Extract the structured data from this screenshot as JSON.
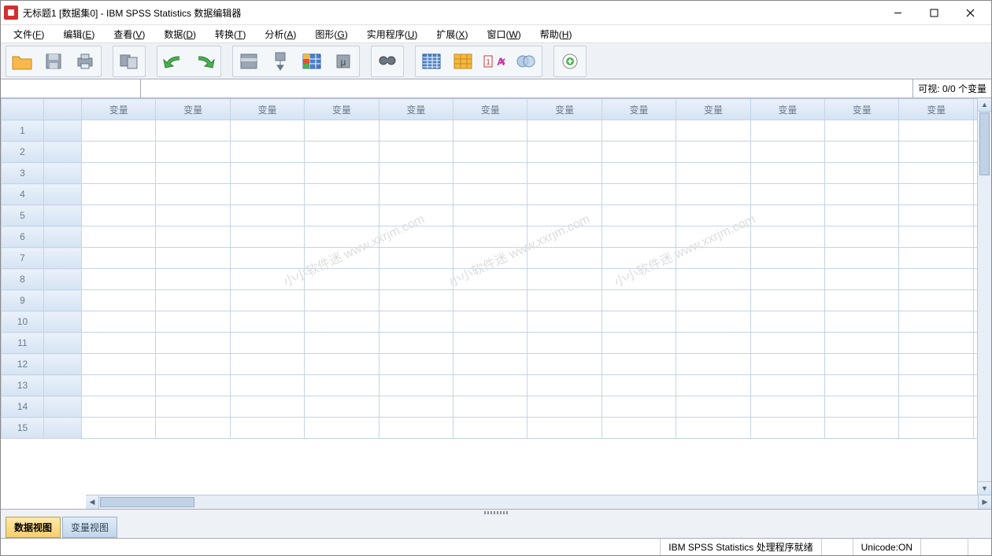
{
  "window": {
    "title": "无标题1 [数据集0] - IBM SPSS Statistics 数据编辑器"
  },
  "menu": {
    "items": [
      {
        "label": "文件",
        "key": "F"
      },
      {
        "label": "编辑",
        "key": "E"
      },
      {
        "label": "查看",
        "key": "V"
      },
      {
        "label": "数据",
        "key": "D"
      },
      {
        "label": "转换",
        "key": "T"
      },
      {
        "label": "分析",
        "key": "A"
      },
      {
        "label": "图形",
        "key": "G"
      },
      {
        "label": "实用程序",
        "key": "U"
      },
      {
        "label": "扩展",
        "key": "X"
      },
      {
        "label": "窗口",
        "key": "W"
      },
      {
        "label": "帮助",
        "key": "H"
      }
    ]
  },
  "toolbar": {
    "icons": [
      "open-file",
      "save",
      "print",
      "recall-dialog",
      "undo",
      "redo",
      "goto-case",
      "goto-variable",
      "variables",
      "run-descriptives",
      "find",
      "split-file",
      "weight-cases",
      "select-cases",
      "value-labels",
      "use-sets",
      "add"
    ]
  },
  "namebar": {
    "visible_label": "可视:",
    "visible_count": "0/0 个变量"
  },
  "grid": {
    "column_header": "变量",
    "columns": 12,
    "rows": [
      1,
      2,
      3,
      4,
      5,
      6,
      7,
      8,
      9,
      10,
      11,
      12,
      13,
      14,
      15
    ]
  },
  "tabs": {
    "data_view": "数据视图",
    "variable_view": "变量视图"
  },
  "status": {
    "processor": "IBM SPSS Statistics 处理程序就绪",
    "unicode": "Unicode:ON"
  },
  "watermark": "小小软件迷 www.xxrjm.com"
}
